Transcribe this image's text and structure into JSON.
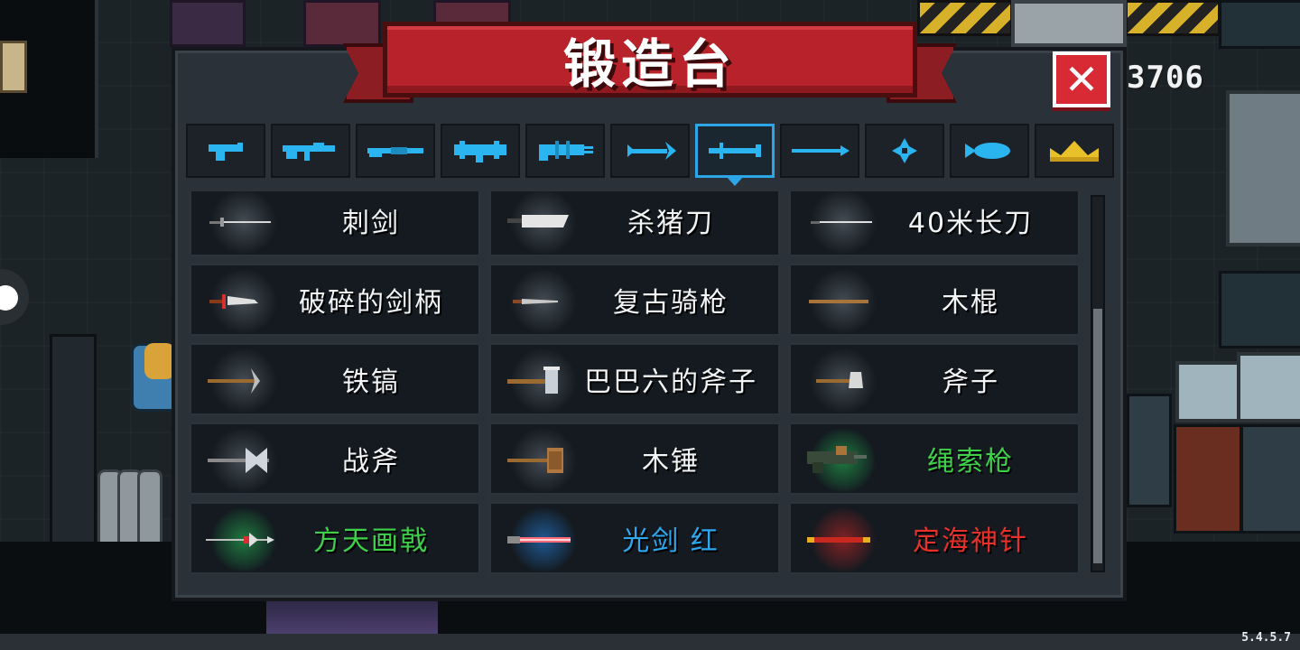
{
  "window": {
    "title": "锻造台",
    "close_label": "✕"
  },
  "hud": {
    "gold": "3706",
    "version": "5.4.5.7"
  },
  "tabs": [
    {
      "icon": "pistol-icon",
      "selected": false
    },
    {
      "icon": "rifle-icon",
      "selected": false
    },
    {
      "icon": "shotgun-icon",
      "selected": false
    },
    {
      "icon": "launcher-icon",
      "selected": false
    },
    {
      "icon": "gatling-icon",
      "selected": false
    },
    {
      "icon": "bow-icon",
      "selected": false
    },
    {
      "icon": "melee-icon",
      "selected": true
    },
    {
      "icon": "spear-icon",
      "selected": false
    },
    {
      "icon": "shuriken-icon",
      "selected": false
    },
    {
      "icon": "fish-icon",
      "selected": false
    },
    {
      "icon": "crown-icon",
      "selected": false
    }
  ],
  "weapons": [
    [
      {
        "name": "刺剑",
        "color": "#f2f4f5",
        "glow": "gray",
        "icon": "rapier-icon"
      },
      {
        "name": "杀猪刀",
        "color": "#f2f4f5",
        "glow": "gray",
        "icon": "cleaver-icon"
      },
      {
        "name": "40米长刀",
        "color": "#f2f4f5",
        "glow": "gray",
        "icon": "long-blade-icon"
      }
    ],
    [
      {
        "name": "破碎的剑柄",
        "color": "#f2f4f5",
        "glow": "gray",
        "icon": "broken-hilt-icon"
      },
      {
        "name": "复古骑枪",
        "color": "#f2f4f5",
        "glow": "gray",
        "icon": "lance-icon"
      },
      {
        "name": "木棍",
        "color": "#f2f4f5",
        "glow": "gray",
        "icon": "stick-icon"
      }
    ],
    [
      {
        "name": "铁镐",
        "color": "#f2f4f5",
        "glow": "gray",
        "icon": "pickaxe-icon"
      },
      {
        "name": "巴巴六的斧子",
        "color": "#f2f4f5",
        "glow": "gray",
        "icon": "big-axe-icon"
      },
      {
        "name": "斧子",
        "color": "#f2f4f5",
        "glow": "gray",
        "icon": "axe-icon"
      }
    ],
    [
      {
        "name": "战斧",
        "color": "#f2f4f5",
        "glow": "gray",
        "icon": "battle-axe-icon"
      },
      {
        "name": "木锤",
        "color": "#f2f4f5",
        "glow": "gray",
        "icon": "wood-hammer-icon"
      },
      {
        "name": "绳索枪",
        "color": "#3fd04a",
        "glow": "green",
        "icon": "rope-gun-icon"
      }
    ],
    [
      {
        "name": "方天画戟",
        "color": "#3fd04a",
        "glow": "green",
        "icon": "halberd-icon"
      },
      {
        "name": "光剑  红",
        "color": "#2ea8f0",
        "glow": "blue",
        "icon": "lightsaber-icon"
      },
      {
        "name": "定海神针",
        "color": "#e8302a",
        "glow": "red",
        "icon": "golden-staff-icon"
      }
    ]
  ],
  "scroll": {
    "position_fraction": 0.3,
    "visible_fraction": 0.68
  },
  "colors": {
    "accent": "#2ca6e6",
    "banner": "#b8232b",
    "close": "#d82a35",
    "panel": "#2b3138"
  }
}
